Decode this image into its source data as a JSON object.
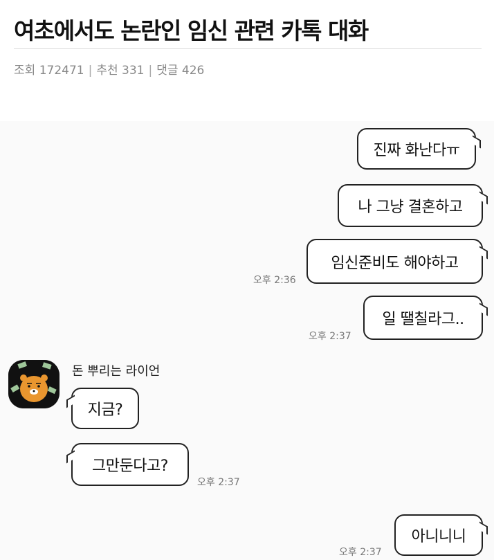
{
  "post": {
    "title": "여초에서도 논란인 임신 관련 카톡 대화",
    "meta": {
      "views_label": "조회",
      "views": "172471",
      "recommends_label": "추천",
      "recommends": "331",
      "comments_label": "댓글",
      "comments": "426"
    }
  },
  "chat": {
    "sender_name": "돈 뿌리는 라이언",
    "avatar_icon": "ryan-money-avatar-icon",
    "messages": [
      {
        "side": "me",
        "text": "진짜 화난다ㅠ"
      },
      {
        "side": "me",
        "text": "나 그냥 결혼하고"
      },
      {
        "side": "me",
        "text": "임신준비도 해야하고",
        "time": "오후 2:36"
      },
      {
        "side": "me",
        "text": "일 땔칠라그..",
        "time": "오후 2:37"
      },
      {
        "side": "them",
        "text": "지금?"
      },
      {
        "side": "them",
        "text": "그만둔다고?",
        "time": "오후 2:37"
      },
      {
        "side": "me",
        "text": "아니니니",
        "time": "오후 2:37"
      }
    ]
  }
}
